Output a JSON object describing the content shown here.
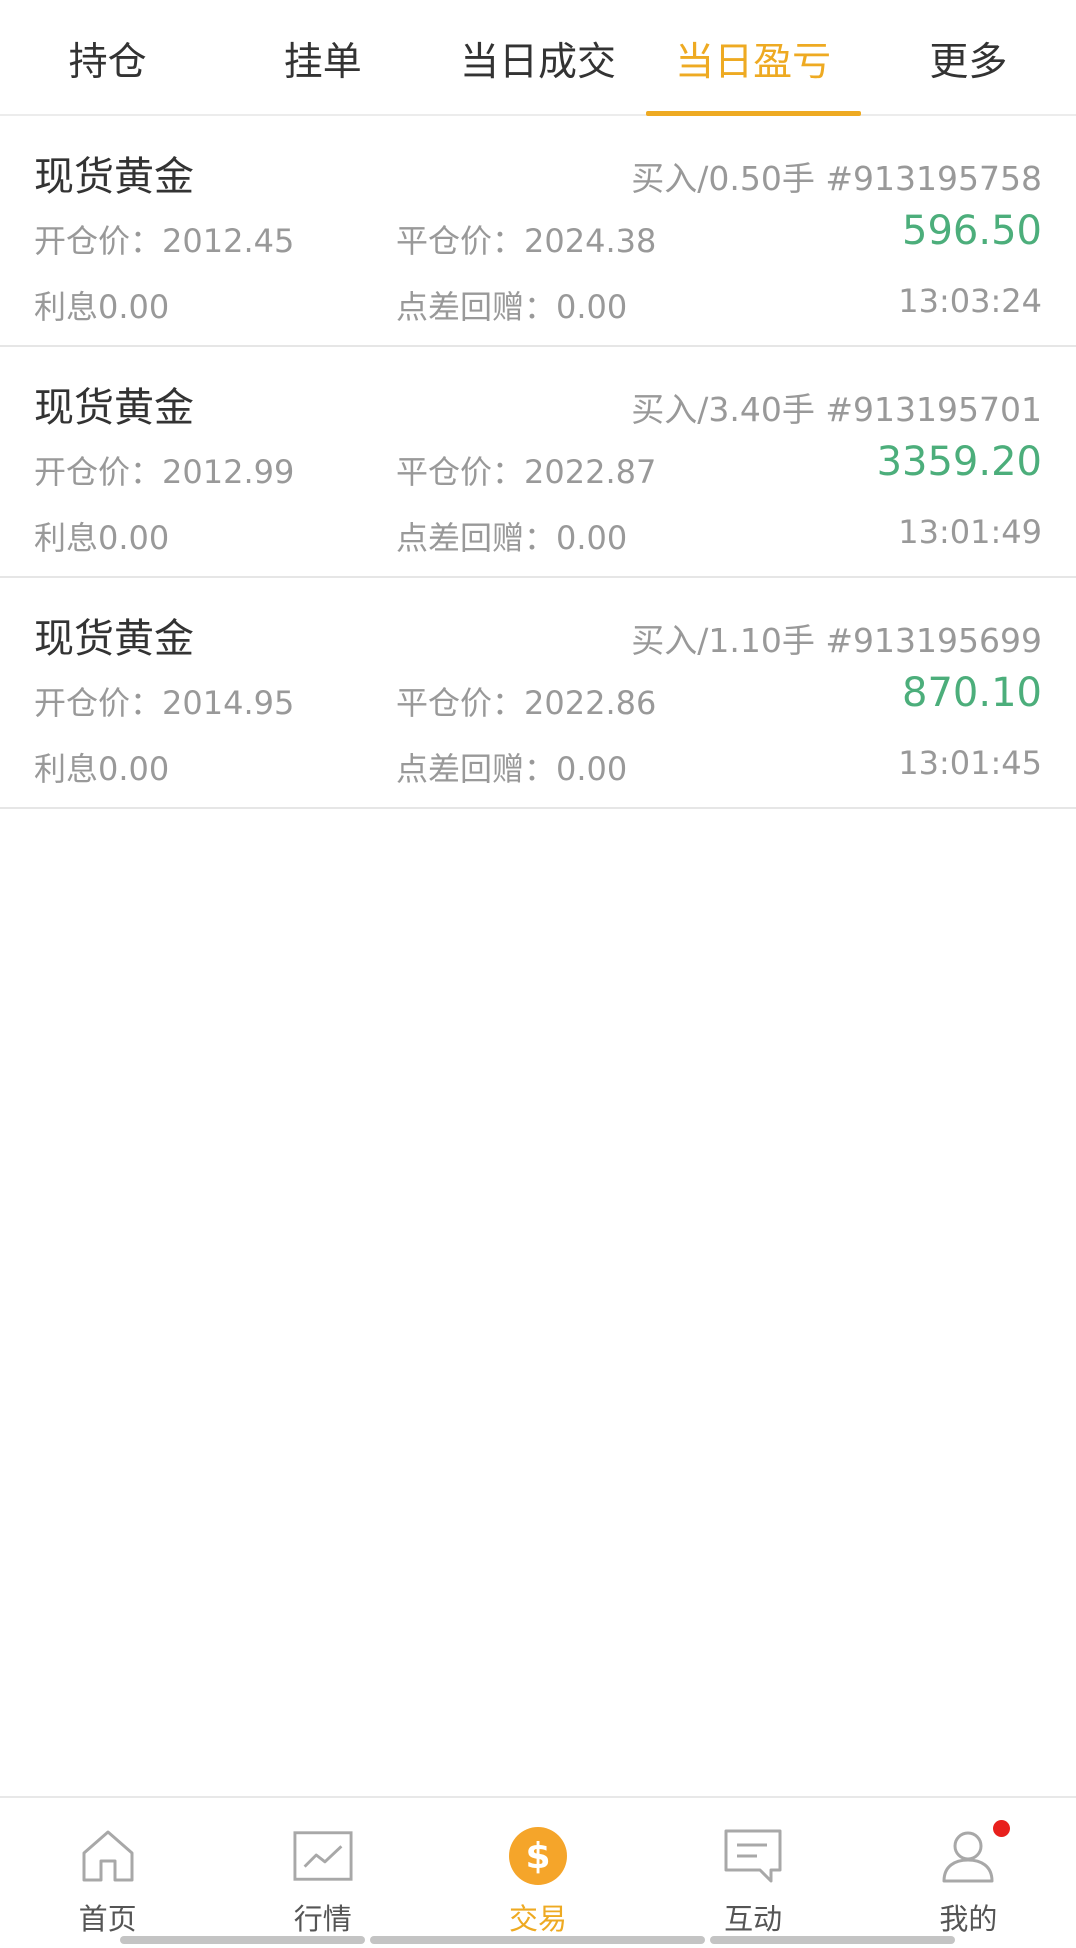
{
  "tabs": [
    {
      "label": "持仓",
      "active": false
    },
    {
      "label": "挂单",
      "active": false
    },
    {
      "label": "当日成交",
      "active": false
    },
    {
      "label": "当日盈亏",
      "active": true
    },
    {
      "label": "更多",
      "active": false
    }
  ],
  "records": [
    {
      "name": "现货黄金",
      "side": "买入/0.50手  #913195758",
      "open_label": "开仓价：2012.45",
      "close_label": "平仓价：2024.38",
      "pnl": "596.50",
      "interest": "利息0.00",
      "spread": "点差回赠：0.00",
      "time": "13:03:24"
    },
    {
      "name": "现货黄金",
      "side": "买入/3.40手  #913195701",
      "open_label": "开仓价：2012.99",
      "close_label": "平仓价：2022.87",
      "pnl": "3359.20",
      "interest": "利息0.00",
      "spread": "点差回赠：0.00",
      "time": "13:01:49"
    },
    {
      "name": "现货黄金",
      "side": "买入/1.10手  #913195699",
      "open_label": "开仓价：2014.95",
      "close_label": "平仓价：2022.86",
      "pnl": "870.10",
      "interest": "利息0.00",
      "spread": "点差回赠：0.00",
      "time": "13:01:45"
    }
  ],
  "bottom_nav": [
    {
      "label": "首页",
      "icon": "home-icon"
    },
    {
      "label": "行情",
      "icon": "chart-icon"
    },
    {
      "label": "交易",
      "icon": "trade-coin-icon",
      "coin_glyph": "$"
    },
    {
      "label": "互动",
      "icon": "message-icon"
    },
    {
      "label": "我的",
      "icon": "user-icon"
    }
  ],
  "colors": {
    "accent": "#eeaa22",
    "profit": "#4cae7b",
    "notification": "#e8201d"
  }
}
